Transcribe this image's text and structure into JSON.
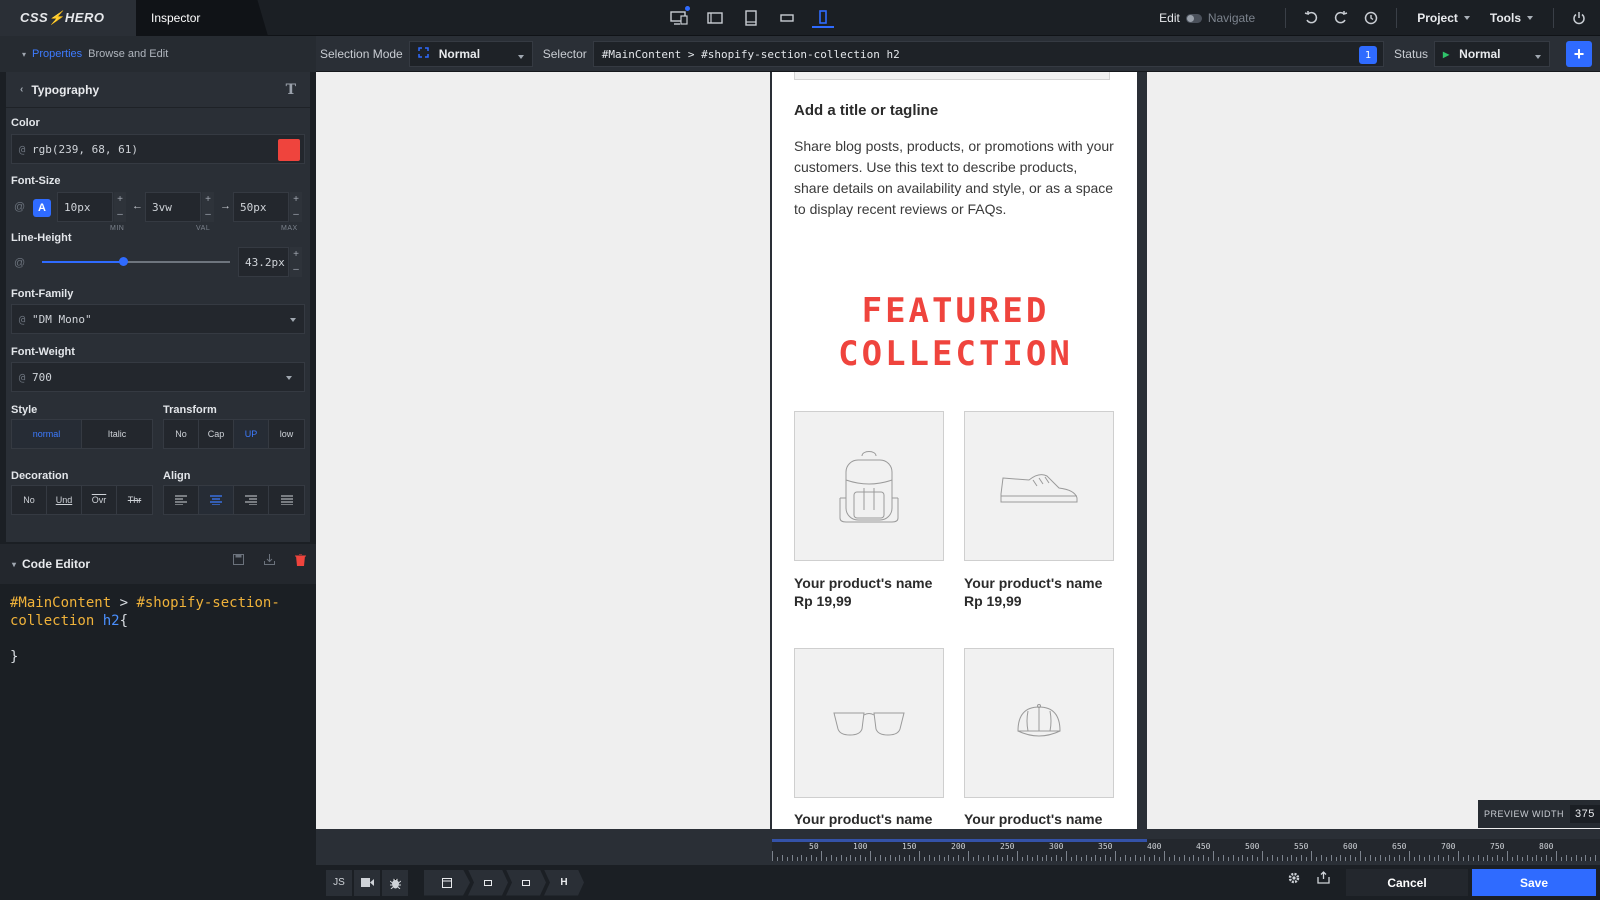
{
  "app": {
    "logo": "CSS⚡HERO",
    "active_tab": "Inspector"
  },
  "toolbar": {
    "edit_label": "Edit",
    "navigate_label": "Navigate",
    "project_label": "Project",
    "tools_label": "Tools"
  },
  "subbar": {
    "properties_label": "Properties",
    "browse_label": "Browse and Edit",
    "selection_mode_label": "Selection Mode",
    "selection_mode_value": "Normal",
    "selector_label": "Selector",
    "selector_value": "#MainContent > #shopify-section-collection h2",
    "selector_count": "1",
    "status_label": "Status",
    "status_value": "Normal"
  },
  "typography": {
    "title": "Typography",
    "color_label": "Color",
    "color_value": "rgb(239, 68, 61)",
    "color_hex": "#ef443d",
    "font_size_label": "Font-Size",
    "font_size_auto": "A",
    "font_size_min": "10px",
    "font_size_val": "3vw",
    "font_size_max": "50px",
    "min_label": "MIN",
    "val_label": "VAL",
    "max_label": "MAX",
    "line_height_label": "Line-Height",
    "line_height_value": "43.2px",
    "line_height_slider_fraction": 0.43,
    "font_family_label": "Font-Family",
    "font_family_value": "\"DM Mono\"",
    "font_weight_label": "Font-Weight",
    "font_weight_value": "700",
    "style_label": "Style",
    "style_options": [
      "normal",
      "Italic"
    ],
    "transform_label": "Transform",
    "transform_options": [
      "No",
      "Cap",
      "UP",
      "low"
    ],
    "decoration_label": "Decoration",
    "decoration_options": [
      "No",
      "Und",
      "Ovr",
      "Thr"
    ],
    "align_label": "Align"
  },
  "code_editor": {
    "title": "Code Editor",
    "line1_id": "#MainContent",
    "line1_op": " > ",
    "line1_id2": "#shopify-section-",
    "line2_id": "collection",
    "line2_tag": " h2",
    "line2_brace": "{",
    "line4": "}"
  },
  "preview": {
    "tagline": "Add a title or tagline",
    "description": "Share blog posts, products, or promotions with your customers. Use this text to describe products, share details on availability and style, or as a space to display recent reviews or FAQs.",
    "featured_line1": "FEATURED",
    "featured_line2": "COLLECTION",
    "products": [
      {
        "name": "Your product's name",
        "price": "Rp 19,99",
        "icon": "backpack-icon"
      },
      {
        "name": "Your product's name",
        "price": "Rp 19,99",
        "icon": "sneaker-icon"
      },
      {
        "name": "Your product's name",
        "icon": "sunglasses-icon"
      },
      {
        "name": "Your product's name",
        "icon": "cap-icon"
      }
    ],
    "preview_width_label": "PREVIEW WIDTH",
    "preview_width_value": "375"
  },
  "ruler": {
    "labels": [
      "50",
      "100",
      "150",
      "200",
      "250",
      "300",
      "350",
      "400",
      "450",
      "500",
      "550",
      "600",
      "650",
      "700",
      "750",
      "800"
    ]
  },
  "bottom": {
    "js_label": "JS",
    "crumb_last": "H",
    "cancel_label": "Cancel",
    "save_label": "Save"
  },
  "colors": {
    "accent": "#2f6bff",
    "heading_red": "#ef443d",
    "code_id": "#f0b23a",
    "code_tag": "#4a90ff"
  }
}
